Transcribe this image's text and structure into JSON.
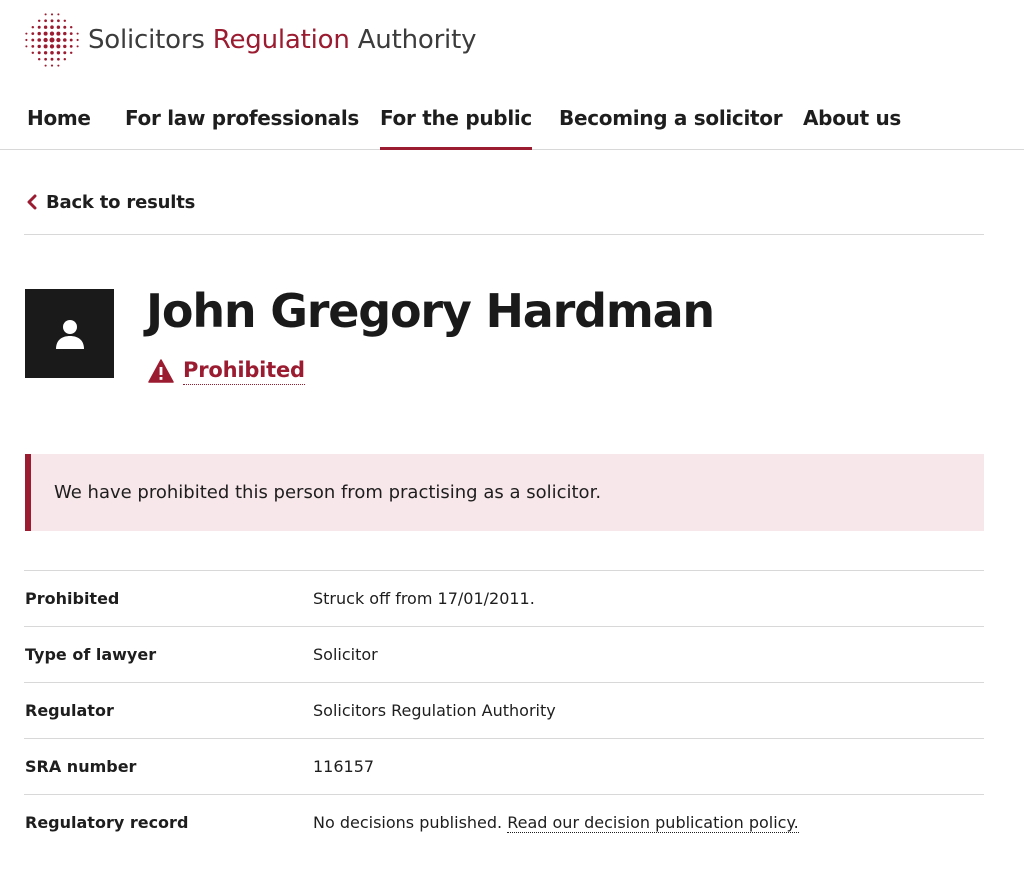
{
  "brand": {
    "name_part1": "Solicitors",
    "name_part2": "Regulation",
    "name_part3": "Authority",
    "accent_color": "#9b1b30"
  },
  "nav": {
    "items": [
      {
        "label": "Home"
      },
      {
        "label": "For law professionals"
      },
      {
        "label": "For the public",
        "active": true
      },
      {
        "label": "Becoming a solicitor"
      },
      {
        "label": "About us"
      }
    ]
  },
  "back": {
    "label": "Back to results",
    "icon": "chevron-left-icon"
  },
  "profile": {
    "name": "John Gregory Hardman",
    "status": "Prohibited",
    "status_icon": "warning-icon",
    "avatar_icon": "person-icon"
  },
  "alert": {
    "message": "We have prohibited this person from practising as a solicitor."
  },
  "details": {
    "rows": [
      {
        "label": "Prohibited",
        "value": "Struck off from 17/01/2011."
      },
      {
        "label": "Type of lawyer",
        "value": "Solicitor"
      },
      {
        "label": "Regulator",
        "value": "Solicitors Regulation Authority"
      },
      {
        "label": "SRA number",
        "value": "116157"
      },
      {
        "label": "Regulatory record",
        "value": "No decisions published.",
        "link_text": "Read our decision publication policy."
      }
    ]
  }
}
